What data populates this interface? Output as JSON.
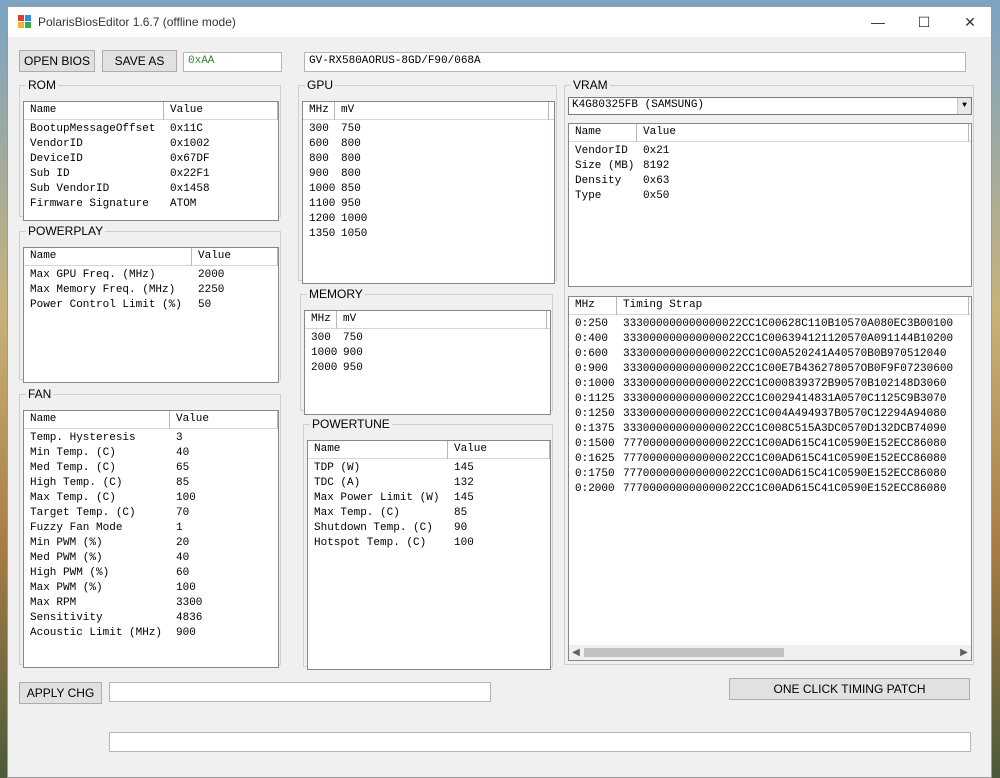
{
  "window": {
    "title": "PolarisBiosEditor 1.6.7 (offline mode)",
    "minimize": "—",
    "maximize": "☐",
    "close": "✕"
  },
  "toolbar": {
    "open_label": "OPEN BIOS",
    "save_as_label": "SAVE AS",
    "checksum": "0xAA",
    "bios_name": "GV-RX580AORUS-8GD/F90/068A"
  },
  "rom": {
    "title": "ROM",
    "headers": [
      "Name",
      "Value"
    ],
    "rows": [
      [
        "BootupMessageOffset",
        "0x11C"
      ],
      [
        "VendorID",
        "0x1002"
      ],
      [
        "DeviceID",
        "0x67DF"
      ],
      [
        "Sub ID",
        "0x22F1"
      ],
      [
        "Sub VendorID",
        "0x1458"
      ],
      [
        "Firmware Signature",
        "ATOM"
      ]
    ]
  },
  "powerplay": {
    "title": "POWERPLAY",
    "headers": [
      "Name",
      "Value"
    ],
    "rows": [
      [
        "Max GPU Freq. (MHz)",
        "2000"
      ],
      [
        "Max Memory Freq. (MHz)",
        "2250"
      ],
      [
        "Power Control Limit (%)",
        "50"
      ]
    ]
  },
  "fan": {
    "title": "FAN",
    "headers": [
      "Name",
      "Value"
    ],
    "rows": [
      [
        "Temp. Hysteresis",
        "3"
      ],
      [
        "Min Temp. (C)",
        "40"
      ],
      [
        "Med Temp. (C)",
        "65"
      ],
      [
        "High Temp. (C)",
        "85"
      ],
      [
        "Max Temp. (C)",
        "100"
      ],
      [
        "Target Temp. (C)",
        "70"
      ],
      [
        "Fuzzy Fan Mode",
        "1"
      ],
      [
        "Min PWM (%)",
        "20"
      ],
      [
        "Med PWM (%)",
        "40"
      ],
      [
        "High PWM (%)",
        "60"
      ],
      [
        "Max PWM (%)",
        "100"
      ],
      [
        "Max RPM",
        "3300"
      ],
      [
        "Sensitivity",
        "4836"
      ],
      [
        "Acoustic Limit (MHz)",
        "900"
      ]
    ]
  },
  "gpu": {
    "title": "GPU",
    "headers": [
      "MHz",
      "mV"
    ],
    "rows": [
      [
        "300",
        "750"
      ],
      [
        "600",
        "800"
      ],
      [
        "800",
        "800"
      ],
      [
        "900",
        "800"
      ],
      [
        "1000",
        "850"
      ],
      [
        "1100",
        "950"
      ],
      [
        "1200",
        "1000"
      ],
      [
        "1350",
        "1050"
      ]
    ]
  },
  "memory": {
    "title": "MEMORY",
    "headers": [
      "MHz",
      "mV"
    ],
    "rows": [
      [
        "300",
        "750"
      ],
      [
        "1000",
        "900"
      ],
      [
        "2000",
        "950"
      ]
    ]
  },
  "powertune": {
    "title": "POWERTUNE",
    "headers": [
      "Name",
      "Value"
    ],
    "rows": [
      [
        "TDP (W)",
        "145"
      ],
      [
        "TDC (A)",
        "132"
      ],
      [
        "Max Power Limit (W)",
        "145"
      ],
      [
        "Max Temp. (C)",
        "85"
      ],
      [
        "Shutdown Temp. (C)",
        "90"
      ],
      [
        "Hotspot Temp. (C)",
        "100"
      ]
    ]
  },
  "vram": {
    "title": "VRAM",
    "selected": "K4G80325FB (SAMSUNG)",
    "headers": [
      "Name",
      "Value"
    ],
    "rows": [
      [
        "VendorID",
        "0x21"
      ],
      [
        "Size (MB)",
        "8192"
      ],
      [
        "Density",
        "0x63"
      ],
      [
        "Type",
        "0x50"
      ]
    ],
    "timing_headers": [
      "MHz",
      "Timing Strap"
    ],
    "timings": [
      [
        "0:250",
        "333000000000000022CC1C00628C110B10570A080EC3B00100"
      ],
      [
        "0:400",
        "333000000000000022CC1C006394121120570A091144B10200"
      ],
      [
        "0:600",
        "333000000000000022CC1C00A520241A40570B0B970512040"
      ],
      [
        "0:900",
        "333000000000000022CC1C00E7B436278057OB0F9F07230600"
      ],
      [
        "0:1000",
        "333000000000000022CC1C000839372B90570B102148D3060"
      ],
      [
        "0:1125",
        "333000000000000022CC1C0029414831A0570C1125C9B3070"
      ],
      [
        "0:1250",
        "333000000000000022CC1C004A494937B0570C12294A94080"
      ],
      [
        "0:1375",
        "333000000000000022CC1C008C515A3DC0570D132DCB74090"
      ],
      [
        "0:1500",
        "777000000000000022CC1C00AD615C41C0590E152ECC86080"
      ],
      [
        "0:1625",
        "777000000000000022CC1C00AD615C41C0590E152ECC86080"
      ],
      [
        "0:1750",
        "777000000000000022CC1C00AD615C41C0590E152ECC86080"
      ],
      [
        "0:2000",
        "777000000000000022CC1C00AD615C41C0590E152ECC86080"
      ]
    ]
  },
  "bottom": {
    "apply_label": "APPLY CHG",
    "apply_value": "",
    "patch_label": "ONE CLICK TIMING PATCH",
    "status_value": ""
  },
  "scroll": {
    "left": "◀",
    "right": "▶"
  }
}
